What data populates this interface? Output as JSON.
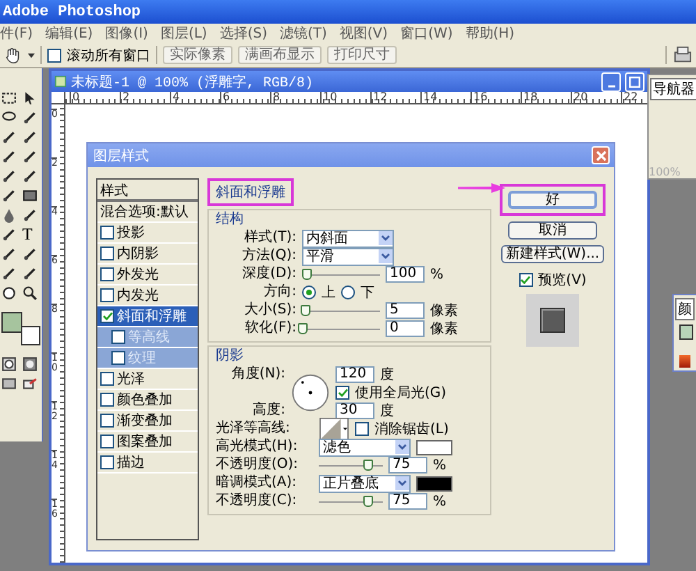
{
  "app": {
    "title": "Adobe Photoshop"
  },
  "menu": [
    "件(F)",
    "编辑(E)",
    "图像(I)",
    "图层(L)",
    "选择(S)",
    "滤镜(T)",
    "视图(V)",
    "窗口(W)",
    "帮助(H)"
  ],
  "options_bar": {
    "scroll_all": {
      "label": "滚动所有窗口",
      "checked": false
    },
    "buttons": [
      "实际像素",
      "满画布显示",
      "打印尺寸"
    ]
  },
  "toolbox": {
    "text_tool": "T",
    "swatches": [
      {
        "kind": "foreground",
        "color": "#a6c49e"
      },
      {
        "kind": "background",
        "color": "#ffffff"
      }
    ]
  },
  "navigator_panel": {
    "tab": "导航器",
    "zoom": "100%"
  },
  "color_panel": {
    "tab": "颜"
  },
  "document": {
    "title": "未标题-1 @ 100% (浮雕字, RGB/8)",
    "top_ruler": [
      "0",
      "2",
      "4",
      "6",
      "8",
      "10",
      "12",
      "14",
      "16",
      "18",
      "20",
      "22"
    ],
    "left_ruler": [
      "0",
      "2",
      "4",
      "6",
      "8",
      "10",
      "12",
      "14",
      "16"
    ]
  },
  "dialog": {
    "title": "图层样式",
    "styles": {
      "header": "样式",
      "blending": "混合选项:默认",
      "items": [
        {
          "label": "投影",
          "checked": false,
          "selected": false
        },
        {
          "label": "内阴影",
          "checked": false,
          "selected": false
        },
        {
          "label": "外发光",
          "checked": false,
          "selected": false
        },
        {
          "label": "内发光",
          "checked": false,
          "selected": false
        },
        {
          "label": "斜面和浮雕",
          "checked": true,
          "selected": true,
          "children": [
            {
              "label": "等高线",
              "checked": false
            },
            {
              "label": "纹理",
              "checked": false
            }
          ]
        },
        {
          "label": "光泽",
          "checked": false,
          "selected": false
        },
        {
          "label": "颜色叠加",
          "checked": false,
          "selected": false
        },
        {
          "label": "渐变叠加",
          "checked": false,
          "selected": false
        },
        {
          "label": "图案叠加",
          "checked": false,
          "selected": false
        },
        {
          "label": "描边",
          "checked": false,
          "selected": false
        }
      ]
    },
    "panel_title": "斜面和浮雕",
    "structure": {
      "title": "结构",
      "style": {
        "label": "样式(T):",
        "value": "内斜面"
      },
      "technique": {
        "label": "方法(Q):",
        "value": "平滑"
      },
      "depth": {
        "label": "深度(D):",
        "level": 0.05,
        "value": "100",
        "unit": "%"
      },
      "direction": {
        "label": "方向:",
        "options": [
          {
            "label": "上",
            "selected": true
          },
          {
            "label": "下",
            "selected": false
          }
        ]
      },
      "size": {
        "label": "大小(S):",
        "level": 0.03,
        "value": "5",
        "unit": "像素"
      },
      "soften": {
        "label": "软化(F):",
        "level": 0.0,
        "value": "0",
        "unit": "像素"
      }
    },
    "shading": {
      "title": "阴影",
      "angle": {
        "label": "角度(N):",
        "value": "120",
        "unit": "度"
      },
      "global_light": {
        "label": "使用全局光(G)",
        "checked": true
      },
      "altitude": {
        "label": "高度:",
        "value": "30",
        "unit": "度"
      },
      "gloss_contour": {
        "label": "光泽等高线:"
      },
      "anti_aliased": {
        "label": "消除锯齿(L)",
        "checked": false
      },
      "highlight_mode": {
        "label": "高光模式(H):",
        "value": "滤色",
        "color": "#ffffff"
      },
      "highlight_opacity": {
        "label": "不透明度(O):",
        "level": 0.75,
        "value": "75",
        "unit": "%"
      },
      "shadow_mode": {
        "label": "暗调模式(A):",
        "value": "正片叠底",
        "color": "#000000"
      },
      "shadow_opacity": {
        "label": "不透明度(C):",
        "level": 0.75,
        "value": "75",
        "unit": "%"
      }
    },
    "buttons": [
      {
        "label": "好",
        "default": true
      },
      {
        "label": "取消",
        "default": false
      },
      {
        "label": "新建样式(W)...",
        "default": false
      }
    ],
    "preview": {
      "label": "预览(V)",
      "checked": true
    }
  }
}
